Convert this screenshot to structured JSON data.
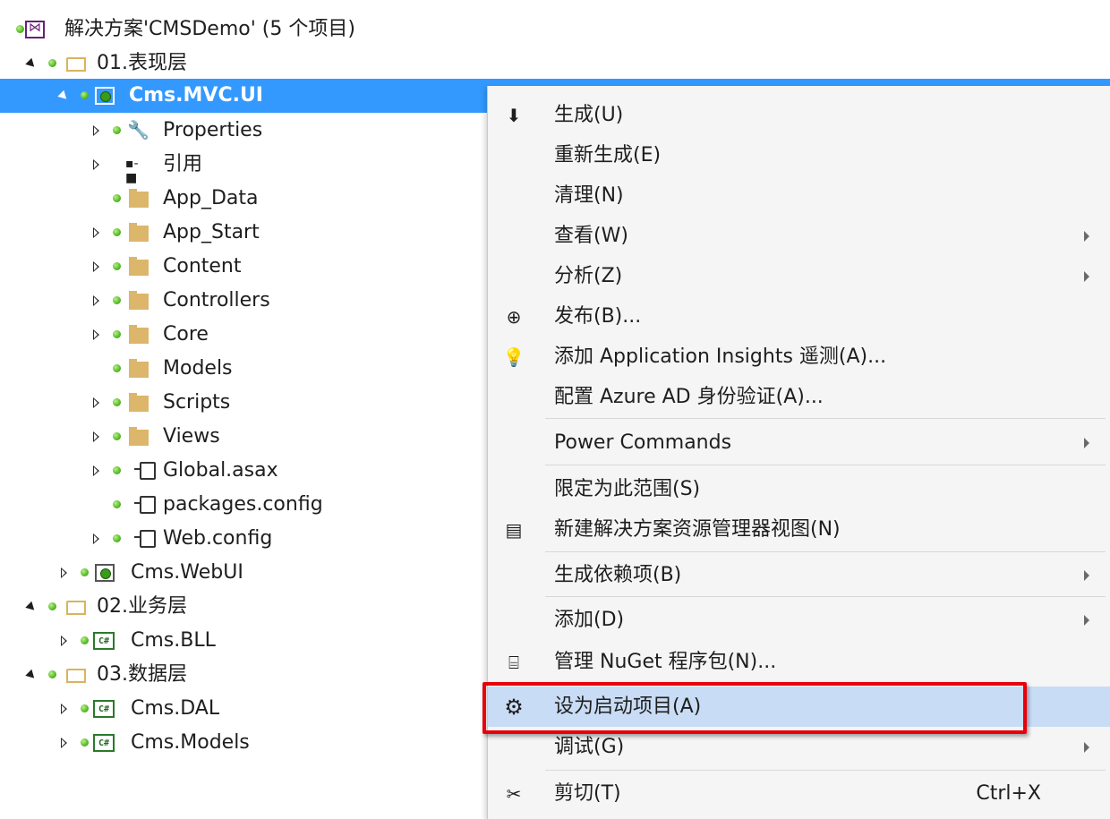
{
  "tree": {
    "solution": "解决方案'CMSDemo' (5 个项目)",
    "folder1": "01.表现层",
    "project_selected": "Cms.MVC.UI",
    "items": [
      "Properties",
      "引用",
      "App_Data",
      "App_Start",
      "Content",
      "Controllers",
      "Core",
      "Models",
      "Scripts",
      "Views",
      "Global.asax",
      "packages.config",
      "Web.config"
    ],
    "project_webui": "Cms.WebUI",
    "folder2": "02.业务层",
    "project_bll": "Cms.BLL",
    "folder3": "03.数据层",
    "project_dal": "Cms.DAL",
    "project_models": "Cms.Models"
  },
  "menu": {
    "items": [
      {
        "label": "生成(U)",
        "icon": "build-icon"
      },
      {
        "label": "重新生成(E)"
      },
      {
        "label": "清理(N)"
      },
      {
        "label": "查看(W)",
        "submenu": true
      },
      {
        "label": "分析(Z)",
        "submenu": true
      },
      {
        "label": "发布(B)...",
        "icon": "publish-icon"
      },
      {
        "label": "添加 Application Insights 遥测(A)...",
        "icon": "insights-icon"
      },
      {
        "label": "配置 Azure AD 身份验证(A)..."
      },
      {
        "label": "Power Commands",
        "submenu": true
      },
      {
        "label": "限定为此范围(S)"
      },
      {
        "label": "新建解决方案资源管理器视图(N)",
        "icon": "new-view-icon"
      },
      {
        "label": "生成依赖项(B)",
        "submenu": true
      },
      {
        "label": "添加(D)",
        "submenu": true
      },
      {
        "label": "管理 NuGet 程序包(N)...",
        "icon": "nuget-icon"
      },
      {
        "label": "设为启动项目(A)",
        "icon": "gear-icon",
        "highlighted": true
      },
      {
        "label": "调试(G)",
        "submenu": true
      },
      {
        "label": "剪切(T)",
        "icon": "scissors-icon",
        "shortcut": "Ctrl+X"
      }
    ]
  },
  "colors": {
    "selection": "#3399ff",
    "highlight": "#c9dcf5",
    "callout": "#e8000b"
  }
}
